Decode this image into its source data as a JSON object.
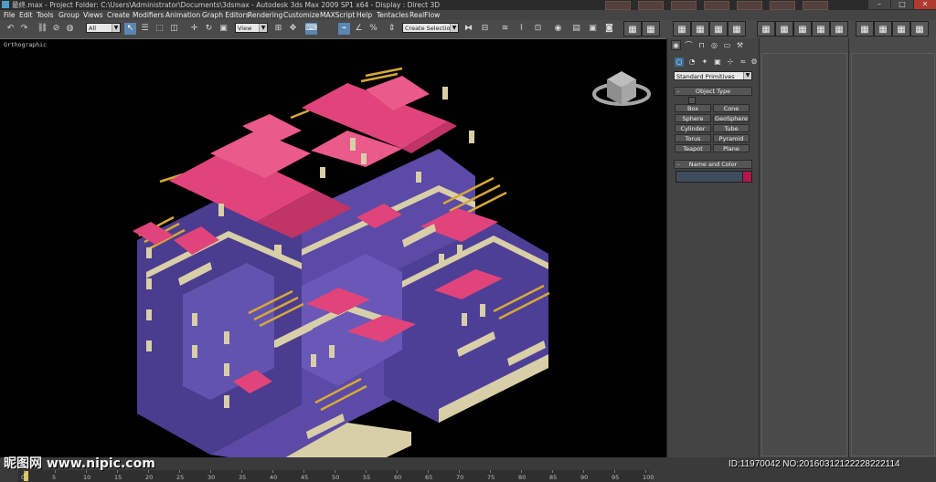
{
  "window": {
    "title": "最终.max  - Project Folder: C:\\Users\\Administrator\\Documents\\3dsmax  - Autodesk 3ds Max  2009 SP1  x64      - Display : Direct 3D",
    "minimize_glyph": "–",
    "maximize_glyph": "□",
    "close_glyph": "✕"
  },
  "menu": [
    "File",
    "Edit",
    "Tools",
    "Group",
    "Views",
    "Create",
    "Modifiers",
    "Animation",
    "Graph Editors",
    "Rendering",
    "Customize",
    "MAXScript",
    "Help",
    "Tentacles",
    "RealFlow"
  ],
  "toolbar": {
    "selection_filter": "All",
    "ref_coord": "View",
    "named_selection": "Create Selection Se",
    "undo": "↶",
    "redo": "↷",
    "select_icon": "↖",
    "move_icon": "✛",
    "rotate_icon": "↻",
    "scale_icon": "▣"
  },
  "viewport": {
    "label": "Orthographic",
    "scene": "isometric villa model with pink roofs and purple walls"
  },
  "command_panel": {
    "category": "Standard Primitives",
    "object_type_rollout": "Object Type",
    "name_color_rollout": "Name and Color",
    "rollout_sign": "-",
    "primitives": [
      "Box",
      "Cone",
      "Sphere",
      "GeoSphere",
      "Cylinder",
      "Tube",
      "Torus",
      "Pyramid",
      "Teapot",
      "Plane"
    ],
    "object_color": "#b3184a"
  },
  "timeline": {
    "ticks": [
      "0",
      "5",
      "10",
      "15",
      "20",
      "25",
      "30",
      "35",
      "40",
      "45",
      "50",
      "55",
      "60",
      "65",
      "70",
      "75",
      "80",
      "85",
      "90",
      "95",
      "100"
    ]
  },
  "watermark": {
    "left": "昵图网 www.nipic.com",
    "right": "ID:11970042 NO:20160312122228222114"
  },
  "colors": {
    "roof": "#e0447a",
    "wall": "#5b4aa6",
    "trim": "#d8cfa8",
    "pergola": "#d8a838",
    "viewport_bg": "#000000"
  }
}
